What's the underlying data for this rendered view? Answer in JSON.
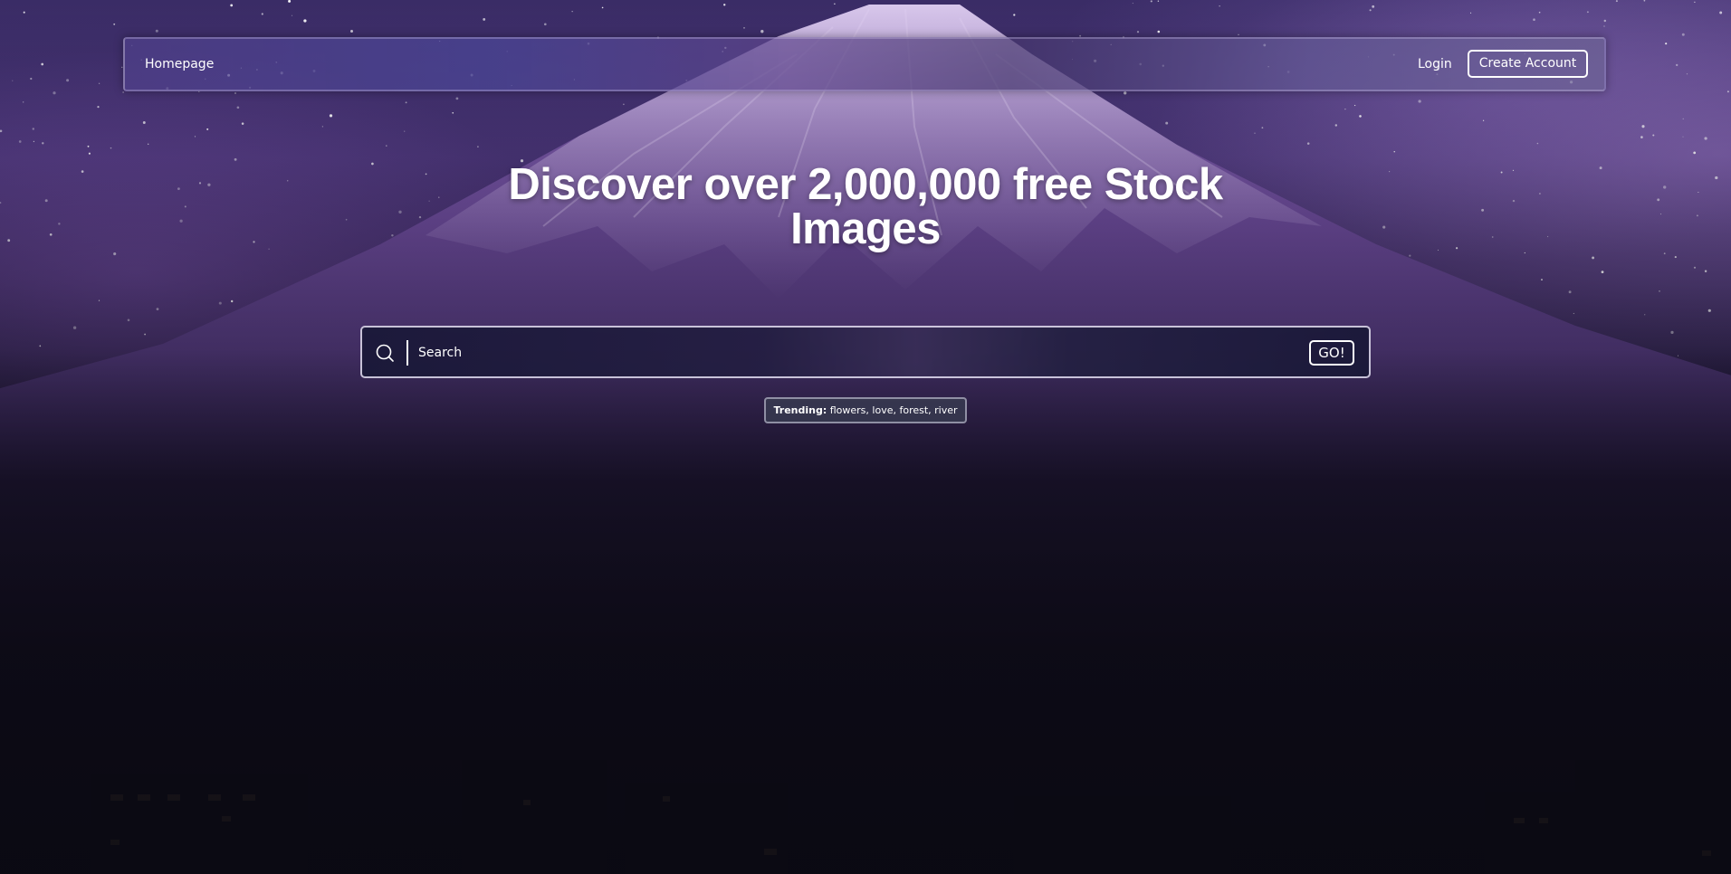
{
  "navbar": {
    "home_label": "Homepage",
    "login_label": "Login",
    "create_account_label": "Create Account"
  },
  "hero": {
    "title": "Discover over 2,000,000 free Stock Images"
  },
  "search": {
    "placeholder": "Search",
    "value": "",
    "go_label": "GO!",
    "icon": "search-icon"
  },
  "trending": {
    "label": "Trending:",
    "terms": "flowers, love, forest, river"
  },
  "colors": {
    "text": "#ffffff",
    "sky": "#3a2c66",
    "mountain": "#6a4a9a",
    "night": "#0c0a14"
  }
}
